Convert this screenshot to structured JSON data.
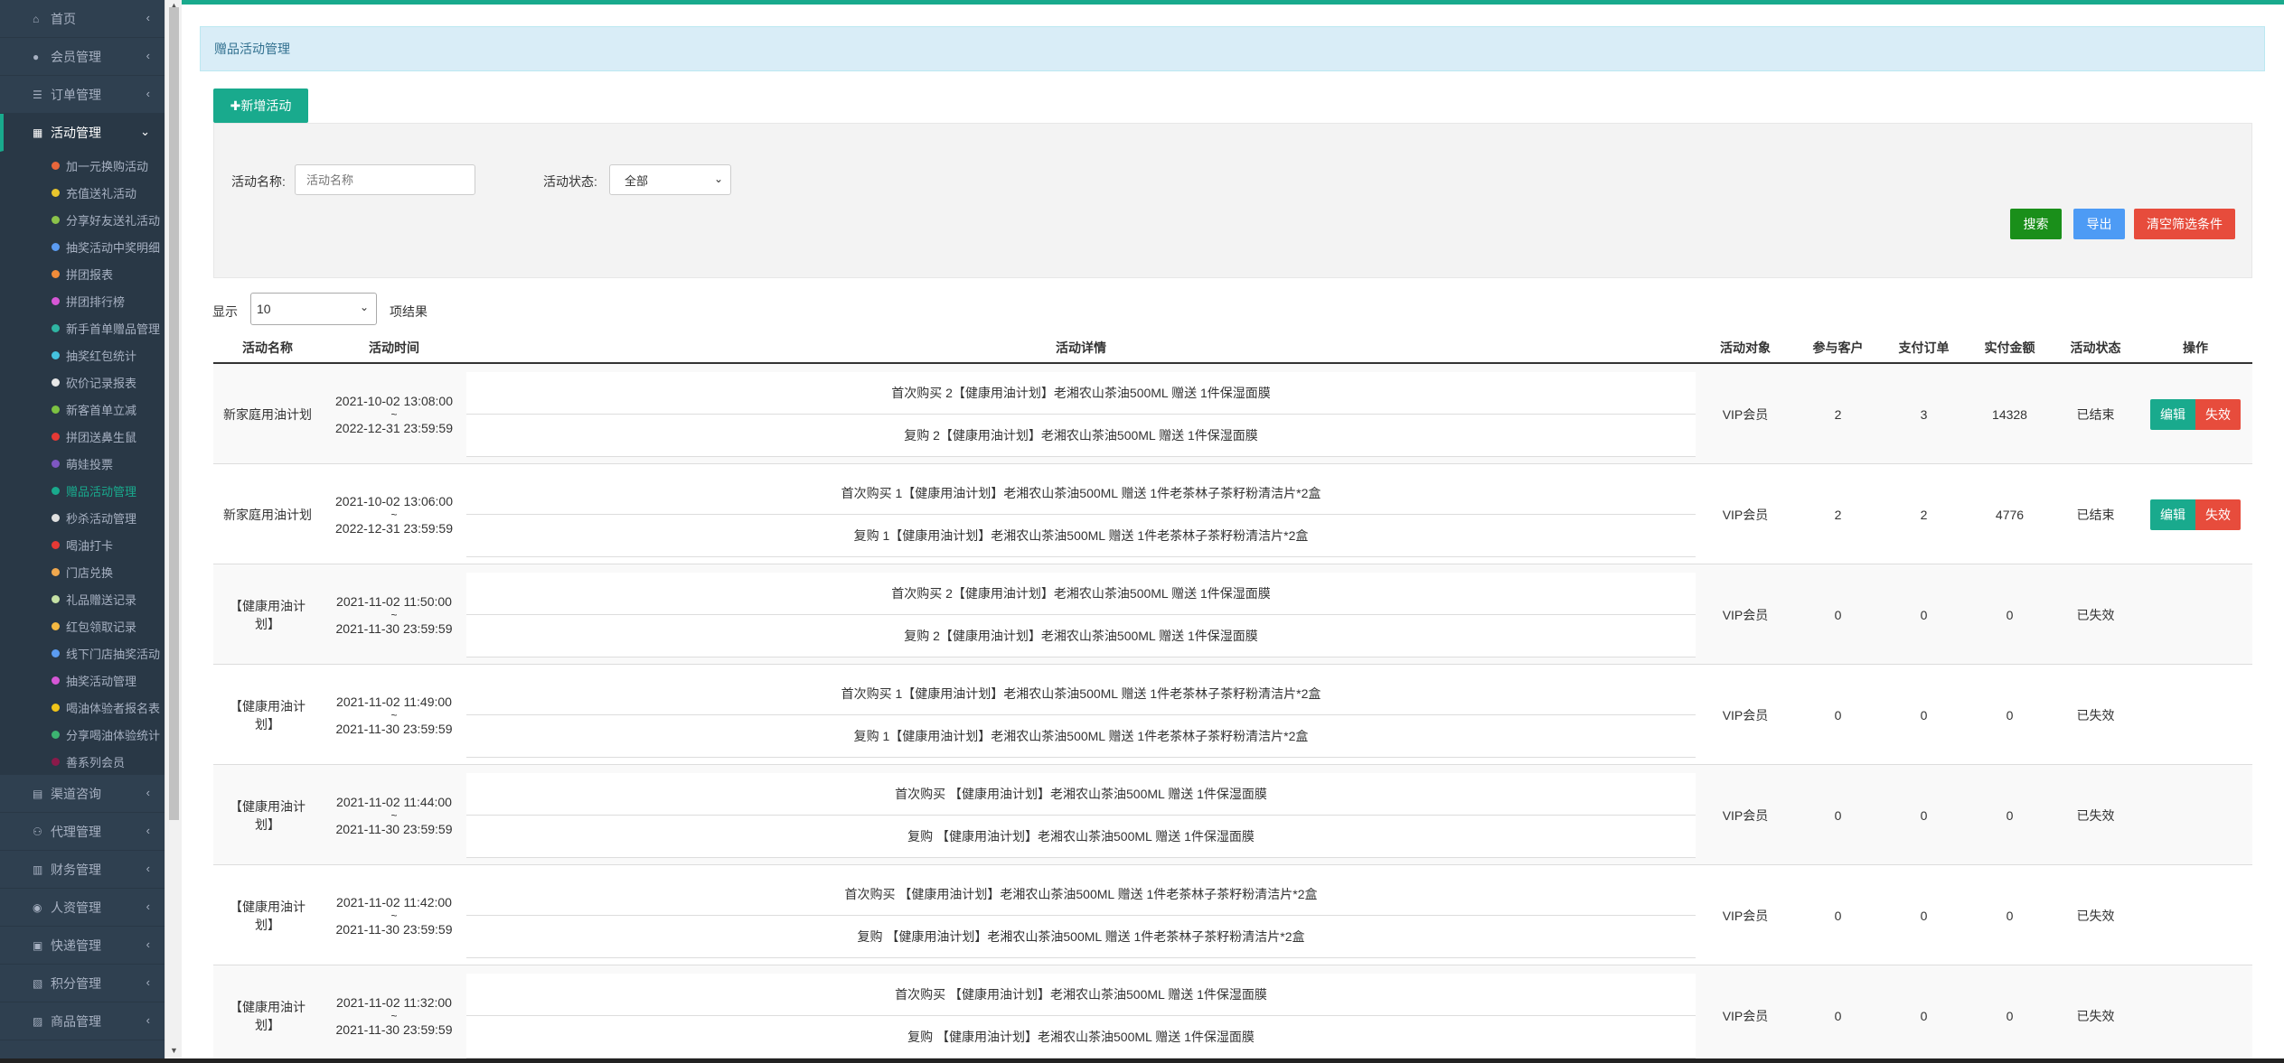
{
  "sidebar": {
    "items": [
      {
        "icon": "home-icon",
        "glyph": "⌂",
        "label": "首页"
      },
      {
        "icon": "user-icon",
        "glyph": "●",
        "label": "会员管理"
      },
      {
        "icon": "list-icon",
        "glyph": "☰",
        "label": "订单管理"
      },
      {
        "icon": "shop-icon",
        "glyph": "▦",
        "label": "活动管理"
      }
    ],
    "sub_items": [
      {
        "label": "加一元换购活动",
        "color": "#e8663b"
      },
      {
        "label": "充值送礼活动",
        "color": "#e8c52d"
      },
      {
        "label": "分享好友送礼活动",
        "color": "#8bc34a"
      },
      {
        "label": "抽奖活动中奖明细",
        "color": "#5b9cf2"
      },
      {
        "label": "拼团报表",
        "color": "#f08c3a"
      },
      {
        "label": "拼团排行榜",
        "color": "#d657d6"
      },
      {
        "label": "新手首单赠品管理",
        "color": "#2fb5a3"
      },
      {
        "label": "抽奖红包统计",
        "color": "#45c3e0"
      },
      {
        "label": "砍价记录报表",
        "color": "#e8e8e8"
      },
      {
        "label": "新客首单立减",
        "color": "#7dc242"
      },
      {
        "label": "拼团送鼻生鼠",
        "color": "#e53935"
      },
      {
        "label": "萌娃投票",
        "color": "#7e57c2"
      },
      {
        "label": "赠品活动管理",
        "color": "#19aa8d"
      },
      {
        "label": "秒杀活动管理",
        "color": "#e0e0e0"
      },
      {
        "label": "喝油打卡",
        "color": "#e53935"
      },
      {
        "label": "门店兑换",
        "color": "#f0a84e"
      },
      {
        "label": "礼品赠送记录",
        "color": "#c5e1a5"
      },
      {
        "label": "红包领取记录",
        "color": "#f4b942"
      },
      {
        "label": "线下门店抽奖活动",
        "color": "#5b9cf2"
      },
      {
        "label": "抽奖活动管理",
        "color": "#d657d6"
      },
      {
        "label": "喝油体验者报名表",
        "color": "#f0c419"
      },
      {
        "label": "分享喝油体验统计",
        "color": "#3cb371"
      },
      {
        "label": "善系列会员",
        "color": "#8b1a4a"
      }
    ],
    "bottom_items": [
      {
        "icon": "channel-icon",
        "glyph": "▤",
        "label": "渠道咨询"
      },
      {
        "icon": "agent-icon",
        "glyph": "⚇",
        "label": "代理管理"
      },
      {
        "icon": "finance-icon",
        "glyph": "▥",
        "label": "财务管理"
      },
      {
        "icon": "hr-icon",
        "glyph": "◉",
        "label": "人资管理"
      },
      {
        "icon": "express-icon",
        "glyph": "▣",
        "label": "快递管理"
      },
      {
        "icon": "points-icon",
        "glyph": "▧",
        "label": "积分管理"
      },
      {
        "icon": "goods-icon",
        "glyph": "▨",
        "label": "商品管理"
      }
    ]
  },
  "header": {
    "title": "赠品活动管理"
  },
  "toolbar": {
    "add_label": "✚新增活动"
  },
  "filters": {
    "name_label": "活动名称:",
    "name_placeholder": "活动名称",
    "status_label": "活动状态:",
    "status_value": "全部",
    "search_label": "搜索",
    "export_label": "导出",
    "clear_label": "清空筛选条件"
  },
  "length": {
    "prefix": "显示",
    "value": "10",
    "suffix": "项结果"
  },
  "table": {
    "columns": [
      "活动名称",
      "活动时间",
      "活动详情",
      "活动对象",
      "参与客户",
      "支付订单",
      "实付金额",
      "活动状态",
      "操作"
    ],
    "edit_label": "编辑",
    "void_label": "失效",
    "rows": [
      {
        "name": "新家庭用油计划",
        "start": "2021-10-02 13:08:00",
        "end": "2022-12-31 23:59:59",
        "detail1": "首次购买 2【健康用油计划】老湘农山茶油500ML 赠送 1件保湿面膜",
        "detail2": "复购 2【健康用油计划】老湘农山茶油500ML 赠送 1件保湿面膜",
        "target": "VIP会员",
        "customers": "2",
        "orders": "3",
        "amount": "14328",
        "status": "已结束",
        "has_ops": true
      },
      {
        "name": "新家庭用油计划",
        "start": "2021-10-02 13:06:00",
        "end": "2022-12-31 23:59:59",
        "detail1": "首次购买 1【健康用油计划】老湘农山茶油500ML 赠送 1件老茶林子茶籽粉清洁片*2盒",
        "detail2": "复购 1【健康用油计划】老湘农山茶油500ML 赠送 1件老茶林子茶籽粉清洁片*2盒",
        "target": "VIP会员",
        "customers": "2",
        "orders": "2",
        "amount": "4776",
        "status": "已结束",
        "has_ops": true
      },
      {
        "name": "【健康用油计划】",
        "start": "2021-11-02 11:50:00",
        "end": "2021-11-30 23:59:59",
        "detail1": "首次购买 2【健康用油计划】老湘农山茶油500ML 赠送 1件保湿面膜",
        "detail2": "复购 2【健康用油计划】老湘农山茶油500ML 赠送 1件保湿面膜",
        "target": "VIP会员",
        "customers": "0",
        "orders": "0",
        "amount": "0",
        "status": "已失效",
        "has_ops": false
      },
      {
        "name": "【健康用油计划】",
        "start": "2021-11-02 11:49:00",
        "end": "2021-11-30 23:59:59",
        "detail1": "首次购买 1【健康用油计划】老湘农山茶油500ML 赠送 1件老茶林子茶籽粉清洁片*2盒",
        "detail2": "复购 1【健康用油计划】老湘农山茶油500ML 赠送 1件老茶林子茶籽粉清洁片*2盒",
        "target": "VIP会员",
        "customers": "0",
        "orders": "0",
        "amount": "0",
        "status": "已失效",
        "has_ops": false
      },
      {
        "name": "【健康用油计划】",
        "start": "2021-11-02 11:44:00",
        "end": "2021-11-30 23:59:59",
        "detail1": "首次购买 【健康用油计划】老湘农山茶油500ML 赠送 1件保湿面膜",
        "detail2": "复购 【健康用油计划】老湘农山茶油500ML 赠送 1件保湿面膜",
        "target": "VIP会员",
        "customers": "0",
        "orders": "0",
        "amount": "0",
        "status": "已失效",
        "has_ops": false
      },
      {
        "name": "【健康用油计划】",
        "start": "2021-11-02 11:42:00",
        "end": "2021-11-30 23:59:59",
        "detail1": "首次购买 【健康用油计划】老湘农山茶油500ML 赠送 1件老茶林子茶籽粉清洁片*2盒",
        "detail2": "复购 【健康用油计划】老湘农山茶油500ML 赠送 1件老茶林子茶籽粉清洁片*2盒",
        "target": "VIP会员",
        "customers": "0",
        "orders": "0",
        "amount": "0",
        "status": "已失效",
        "has_ops": false
      },
      {
        "name": "【健康用油计划】",
        "start": "2021-11-02 11:32:00",
        "end": "2021-11-30 23:59:59",
        "detail1": "首次购买 【健康用油计划】老湘农山茶油500ML 赠送 1件保湿面膜",
        "detail2": "复购 【健康用油计划】老湘农山茶油500ML 赠送 1件保湿面膜",
        "target": "VIP会员",
        "customers": "0",
        "orders": "0",
        "amount": "0",
        "status": "已失效",
        "has_ops": false
      }
    ]
  },
  "colors": {
    "accent": "#19aa8d",
    "sidebar_bg": "#2f4050",
    "search": "#1a8f1a",
    "export": "#4d9bf5",
    "clear": "#e74c3c"
  }
}
